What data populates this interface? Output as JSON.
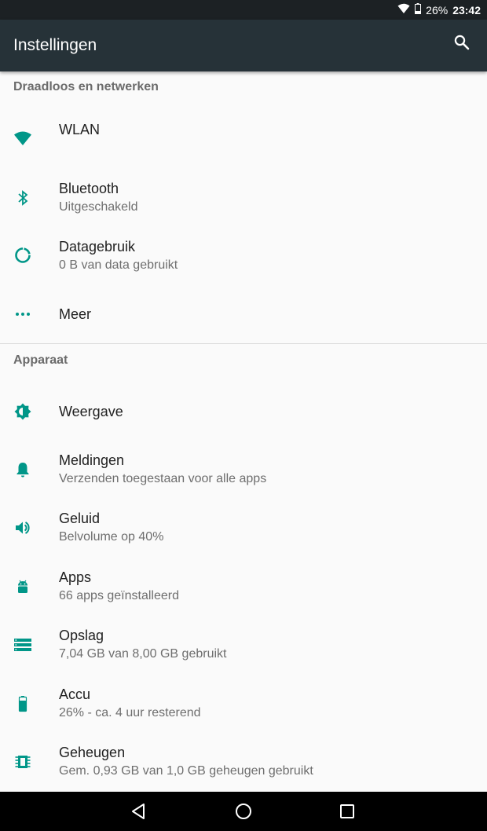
{
  "status_bar": {
    "battery": "26%",
    "time": "23:42"
  },
  "app_bar": {
    "title": "Instellingen"
  },
  "sections": {
    "wireless": {
      "header": "Draadloos en netwerken",
      "items": [
        {
          "title": "WLAN",
          "subtitle": "",
          "icon": "wifi-icon"
        },
        {
          "title": "Bluetooth",
          "subtitle": "Uitgeschakeld",
          "icon": "bluetooth-icon"
        },
        {
          "title": "Datagebruik",
          "subtitle": "0 B van data gebruikt",
          "icon": "data-usage-icon"
        },
        {
          "title": "Meer",
          "subtitle": "",
          "icon": "more-icon"
        }
      ]
    },
    "device": {
      "header": "Apparaat",
      "items": [
        {
          "title": "Weergave",
          "subtitle": "",
          "icon": "brightness-icon"
        },
        {
          "title": "Meldingen",
          "subtitle": "Verzenden toegestaan voor alle apps",
          "icon": "bell-icon"
        },
        {
          "title": "Geluid",
          "subtitle": "Belvolume op 40%",
          "icon": "volume-icon"
        },
        {
          "title": "Apps",
          "subtitle": "66 apps geïnstalleerd",
          "icon": "android-icon"
        },
        {
          "title": "Opslag",
          "subtitle": "7,04 GB van 8,00 GB gebruikt",
          "icon": "storage-icon"
        },
        {
          "title": "Accu",
          "subtitle": "26% - ca. 4 uur resterend",
          "icon": "battery-icon"
        },
        {
          "title": "Geheugen",
          "subtitle": "Gem. 0,93 GB van 1,0 GB geheugen gebruikt",
          "icon": "memory-icon"
        }
      ]
    }
  },
  "colors": {
    "status_bar": "#1c2124",
    "app_bar": "#263238",
    "accent": "#009688",
    "background": "#fafafa",
    "nav_bar": "#000000"
  }
}
